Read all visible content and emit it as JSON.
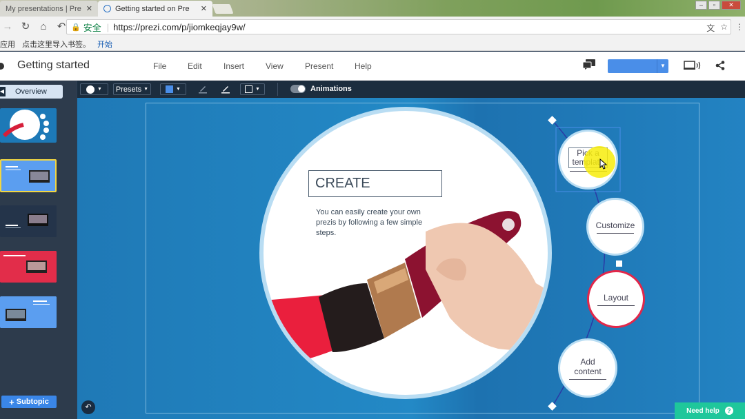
{
  "browser": {
    "tabs": [
      {
        "title": "My presentations | Pre",
        "active": false
      },
      {
        "title": "Getting started on Pre",
        "active": true
      }
    ],
    "url_secure_label": "安全",
    "url": "https://prezi.com/p/jiomkeqjay9w/",
    "bookmarks": [
      "应用",
      "点击这里导入书签。",
      "开始"
    ]
  },
  "app": {
    "title": "Getting started",
    "menu": [
      "File",
      "Edit",
      "Insert",
      "View",
      "Present",
      "Help"
    ]
  },
  "toolbar": {
    "presets_label": "Presets",
    "animations_label": "Animations",
    "colors": {
      "fill": "#4a8ee8"
    }
  },
  "sidebar": {
    "overview_label": "Overview",
    "subtopic_label": "Subtopic"
  },
  "canvas": {
    "create_title": "CREATE",
    "create_body": "You can easily create your own prezis by following a few simple steps.",
    "nodes": [
      {
        "label_line1": "Pick a",
        "label_line2": "template"
      },
      {
        "label_line1": "Customize",
        "label_line2": ""
      },
      {
        "label_line1": "Layout",
        "label_line2": ""
      },
      {
        "label_line1": "Add",
        "label_line2": "content"
      }
    ]
  },
  "help": {
    "label": "Need help"
  }
}
